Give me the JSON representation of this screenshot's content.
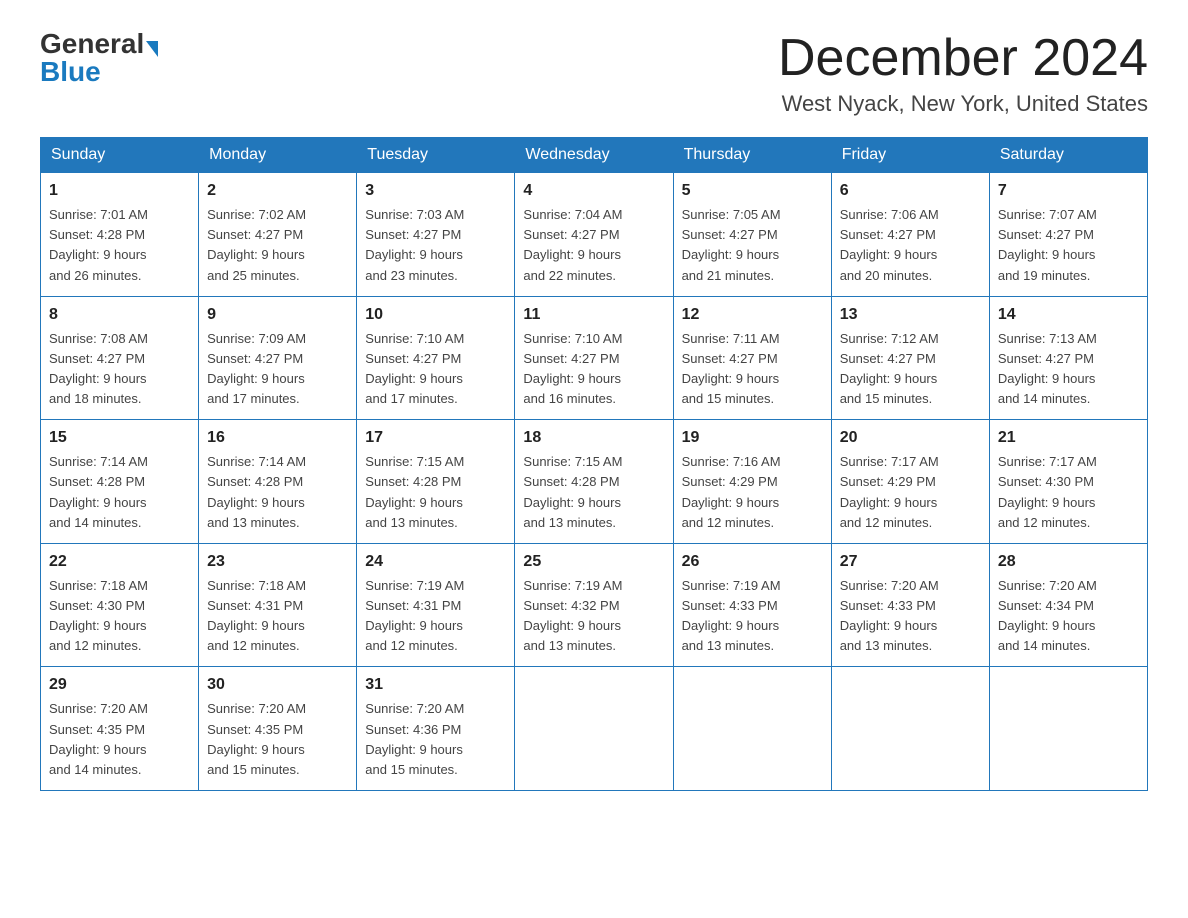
{
  "logo": {
    "general": "General",
    "blue": "Blue"
  },
  "title": {
    "month": "December 2024",
    "location": "West Nyack, New York, United States"
  },
  "weekdays": [
    "Sunday",
    "Monday",
    "Tuesday",
    "Wednesday",
    "Thursday",
    "Friday",
    "Saturday"
  ],
  "weeks": [
    [
      {
        "day": "1",
        "sunrise": "7:01 AM",
        "sunset": "4:28 PM",
        "daylight": "9 hours and 26 minutes."
      },
      {
        "day": "2",
        "sunrise": "7:02 AM",
        "sunset": "4:27 PM",
        "daylight": "9 hours and 25 minutes."
      },
      {
        "day": "3",
        "sunrise": "7:03 AM",
        "sunset": "4:27 PM",
        "daylight": "9 hours and 23 minutes."
      },
      {
        "day": "4",
        "sunrise": "7:04 AM",
        "sunset": "4:27 PM",
        "daylight": "9 hours and 22 minutes."
      },
      {
        "day": "5",
        "sunrise": "7:05 AM",
        "sunset": "4:27 PM",
        "daylight": "9 hours and 21 minutes."
      },
      {
        "day": "6",
        "sunrise": "7:06 AM",
        "sunset": "4:27 PM",
        "daylight": "9 hours and 20 minutes."
      },
      {
        "day": "7",
        "sunrise": "7:07 AM",
        "sunset": "4:27 PM",
        "daylight": "9 hours and 19 minutes."
      }
    ],
    [
      {
        "day": "8",
        "sunrise": "7:08 AM",
        "sunset": "4:27 PM",
        "daylight": "9 hours and 18 minutes."
      },
      {
        "day": "9",
        "sunrise": "7:09 AM",
        "sunset": "4:27 PM",
        "daylight": "9 hours and 17 minutes."
      },
      {
        "day": "10",
        "sunrise": "7:10 AM",
        "sunset": "4:27 PM",
        "daylight": "9 hours and 17 minutes."
      },
      {
        "day": "11",
        "sunrise": "7:10 AM",
        "sunset": "4:27 PM",
        "daylight": "9 hours and 16 minutes."
      },
      {
        "day": "12",
        "sunrise": "7:11 AM",
        "sunset": "4:27 PM",
        "daylight": "9 hours and 15 minutes."
      },
      {
        "day": "13",
        "sunrise": "7:12 AM",
        "sunset": "4:27 PM",
        "daylight": "9 hours and 15 minutes."
      },
      {
        "day": "14",
        "sunrise": "7:13 AM",
        "sunset": "4:27 PM",
        "daylight": "9 hours and 14 minutes."
      }
    ],
    [
      {
        "day": "15",
        "sunrise": "7:14 AM",
        "sunset": "4:28 PM",
        "daylight": "9 hours and 14 minutes."
      },
      {
        "day": "16",
        "sunrise": "7:14 AM",
        "sunset": "4:28 PM",
        "daylight": "9 hours and 13 minutes."
      },
      {
        "day": "17",
        "sunrise": "7:15 AM",
        "sunset": "4:28 PM",
        "daylight": "9 hours and 13 minutes."
      },
      {
        "day": "18",
        "sunrise": "7:15 AM",
        "sunset": "4:28 PM",
        "daylight": "9 hours and 13 minutes."
      },
      {
        "day": "19",
        "sunrise": "7:16 AM",
        "sunset": "4:29 PM",
        "daylight": "9 hours and 12 minutes."
      },
      {
        "day": "20",
        "sunrise": "7:17 AM",
        "sunset": "4:29 PM",
        "daylight": "9 hours and 12 minutes."
      },
      {
        "day": "21",
        "sunrise": "7:17 AM",
        "sunset": "4:30 PM",
        "daylight": "9 hours and 12 minutes."
      }
    ],
    [
      {
        "day": "22",
        "sunrise": "7:18 AM",
        "sunset": "4:30 PM",
        "daylight": "9 hours and 12 minutes."
      },
      {
        "day": "23",
        "sunrise": "7:18 AM",
        "sunset": "4:31 PM",
        "daylight": "9 hours and 12 minutes."
      },
      {
        "day": "24",
        "sunrise": "7:19 AM",
        "sunset": "4:31 PM",
        "daylight": "9 hours and 12 minutes."
      },
      {
        "day": "25",
        "sunrise": "7:19 AM",
        "sunset": "4:32 PM",
        "daylight": "9 hours and 13 minutes."
      },
      {
        "day": "26",
        "sunrise": "7:19 AM",
        "sunset": "4:33 PM",
        "daylight": "9 hours and 13 minutes."
      },
      {
        "day": "27",
        "sunrise": "7:20 AM",
        "sunset": "4:33 PM",
        "daylight": "9 hours and 13 minutes."
      },
      {
        "day": "28",
        "sunrise": "7:20 AM",
        "sunset": "4:34 PM",
        "daylight": "9 hours and 14 minutes."
      }
    ],
    [
      {
        "day": "29",
        "sunrise": "7:20 AM",
        "sunset": "4:35 PM",
        "daylight": "9 hours and 14 minutes."
      },
      {
        "day": "30",
        "sunrise": "7:20 AM",
        "sunset": "4:35 PM",
        "daylight": "9 hours and 15 minutes."
      },
      {
        "day": "31",
        "sunrise": "7:20 AM",
        "sunset": "4:36 PM",
        "daylight": "9 hours and 15 minutes."
      },
      null,
      null,
      null,
      null
    ]
  ],
  "labels": {
    "sunrise": "Sunrise: ",
    "sunset": "Sunset: ",
    "daylight": "Daylight: "
  }
}
